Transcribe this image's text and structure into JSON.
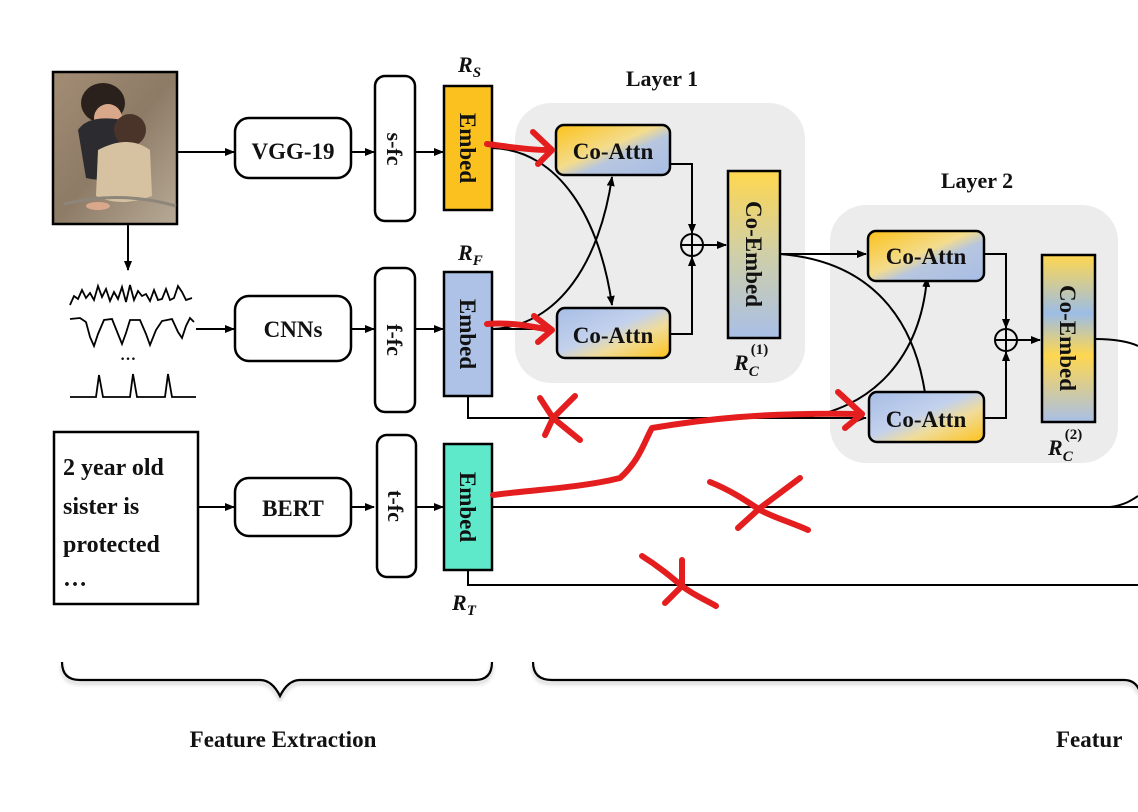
{
  "inputs": {
    "image_alt": "photo of two children hugging",
    "text_lines": [
      "2 year old",
      "sister is",
      "protected",
      "…"
    ],
    "signal_ellipsis": "…"
  },
  "encoders": {
    "image": "VGG-19",
    "signal": "CNNs",
    "text": "BERT"
  },
  "fc": {
    "image": "s-fc",
    "signal": "f-fc",
    "text": "t-fc"
  },
  "embed": {
    "label": "Embed",
    "image_rep": {
      "base": "R",
      "sub": "S"
    },
    "signal_rep": {
      "base": "R",
      "sub": "F"
    },
    "text_rep": {
      "base": "R",
      "sub": "T"
    }
  },
  "layers": [
    {
      "title": "Layer 1",
      "co_attn_top": "Co-Attn",
      "co_attn_bottom": "Co-Attn",
      "co_embed": "Co-Embed",
      "rep": {
        "base": "R",
        "sub": "C",
        "sup": "(1)"
      }
    },
    {
      "title": "Layer 2",
      "co_attn_top": "Co-Attn",
      "co_attn_bottom": "Co-Attn",
      "co_embed": "Co-Embed",
      "rep": {
        "base": "R",
        "sub": "C",
        "sup": "(2)"
      }
    }
  ],
  "sum_symbol": "⊕",
  "sections": {
    "left": "Feature Extraction",
    "right": "Featur"
  },
  "colors": {
    "embed_image": "#fbc21f",
    "embed_signal": "#adc2e6",
    "embed_text": "#5ee9cb",
    "layer_bg": "#ececec",
    "annotation_red": "#e41e1e",
    "gold": "#fdd24a",
    "blue": "#a8bfe6"
  }
}
